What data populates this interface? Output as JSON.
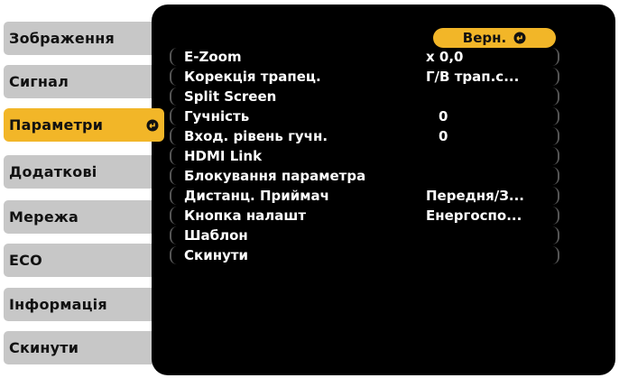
{
  "sidebar": {
    "items": [
      {
        "label": "Зображення"
      },
      {
        "label": "Сигнал"
      },
      {
        "label": "Параметри"
      },
      {
        "label": "Додаткові"
      },
      {
        "label": "Мережа"
      },
      {
        "label": "ECO"
      },
      {
        "label": "Інформація"
      },
      {
        "label": "Скинути"
      }
    ],
    "active_index": 2,
    "active_icon": "enter-icon"
  },
  "panel": {
    "back_label": "Верн.",
    "back_icon": "return-icon",
    "rows": [
      {
        "label": "E-Zoom",
        "value": "x  0,0"
      },
      {
        "label": "Корекція трапец.",
        "value": "Г/В трап.с..."
      },
      {
        "label": "Split Screen",
        "value": ""
      },
      {
        "label": "Гучність",
        "value": "0"
      },
      {
        "label": "Вход. рівень гучн.",
        "value": "0"
      },
      {
        "label": "HDMI Link",
        "value": ""
      },
      {
        "label": "Блокування параметра",
        "value": ""
      },
      {
        "label": "Дистанц. Приймач",
        "value": "Передня/З..."
      },
      {
        "label": "Кнопка налашт",
        "value": "Енергоспо..."
      },
      {
        "label": "Шаблон",
        "value": ""
      },
      {
        "label": "Скинути",
        "value": ""
      }
    ]
  },
  "colors": {
    "accent": "#f2b628",
    "tab_bg": "#c7c7c7",
    "panel_bg": "#000000",
    "text_light": "#ffffff"
  }
}
